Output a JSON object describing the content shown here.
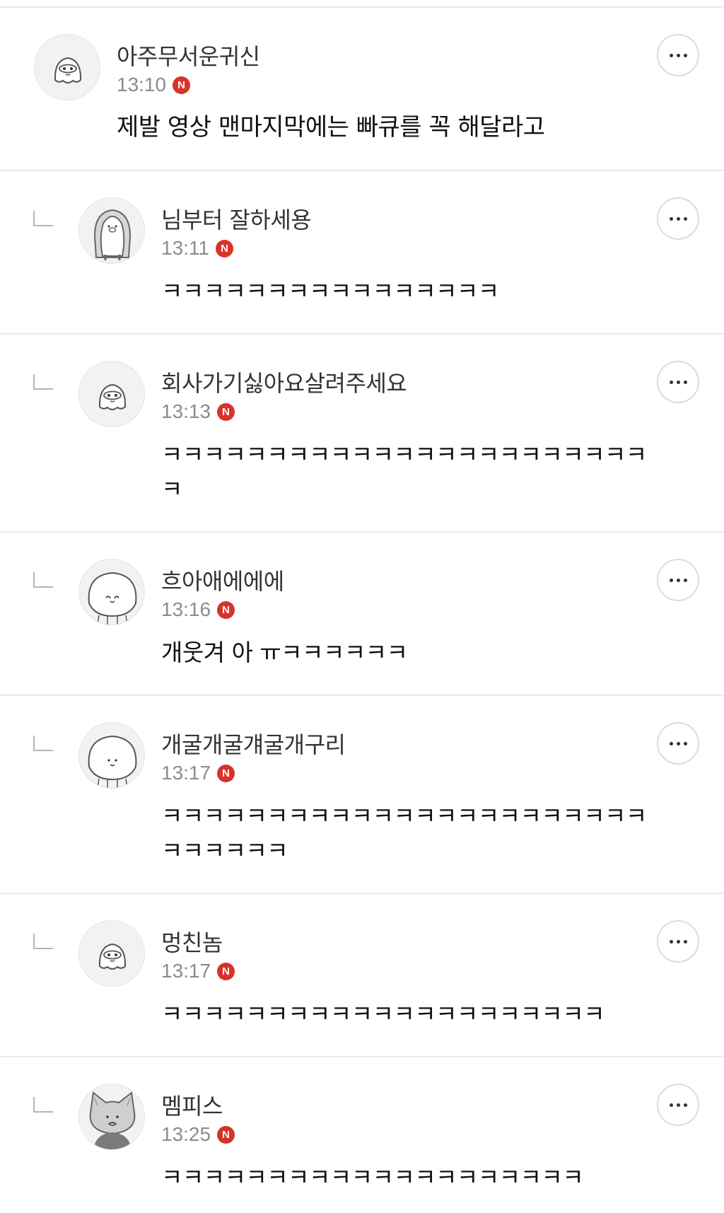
{
  "comments": [
    {
      "nickname": "아주무서운귀신",
      "time": "13:10",
      "badge": "N",
      "text": "제발 영상 맨마지막에는 빠큐를 꼭 해달라고",
      "avatar": "ghost-avatar"
    },
    {
      "nickname": "님부터 잘하세용",
      "time": "13:11",
      "badge": "N",
      "text": "ㅋㅋㅋㅋㅋㅋㅋㅋㅋㅋㅋㅋㅋㅋㅋㅋ",
      "avatar": "penguin-avatar"
    },
    {
      "nickname": "회사가기싫아요살려주세요",
      "time": "13:13",
      "badge": "N",
      "text": "ㅋㅋㅋㅋㅋㅋㅋㅋㅋㅋㅋㅋㅋㅋㅋㅋㅋㅋㅋㅋㅋㅋㅋ\nㅋ",
      "avatar": "ghost-avatar"
    },
    {
      "nickname": "흐아애에에에",
      "time": "13:16",
      "badge": "N",
      "text": "개웃겨 아 ㅠㅋㅋㅋㅋㅋㅋ",
      "avatar": "bun-avatar"
    },
    {
      "nickname": "개굴개굴걔굴개구리",
      "time": "13:17",
      "badge": "N",
      "text": "ㅋㅋㅋㅋㅋㅋㅋㅋㅋㅋㅋㅋㅋㅋㅋㅋㅋㅋㅋㅋㅋㅋㅋ\nㅋㅋㅋㅋㅋㅋ",
      "avatar": "bun-avatar"
    },
    {
      "nickname": "멍친놈",
      "time": "13:17",
      "badge": "N",
      "text": "ㅋㅋㅋㅋㅋㅋㅋㅋㅋㅋㅋㅋㅋㅋㅋㅋㅋㅋㅋㅋㅋ",
      "avatar": "ghost-avatar"
    },
    {
      "nickname": "멤피스",
      "time": "13:25",
      "badge": "N",
      "text": "ㅋㅋㅋㅋㅋㅋㅋㅋㅋㅋㅋㅋㅋㅋㅋㅋㅋㅋㅋㅋ",
      "avatar": "cat-avatar"
    }
  ],
  "more_button_icon": "more-dots-icon",
  "colors": {
    "badge": "#d8322a",
    "divider": "#ebebeb",
    "time": "#8c8c8c"
  }
}
